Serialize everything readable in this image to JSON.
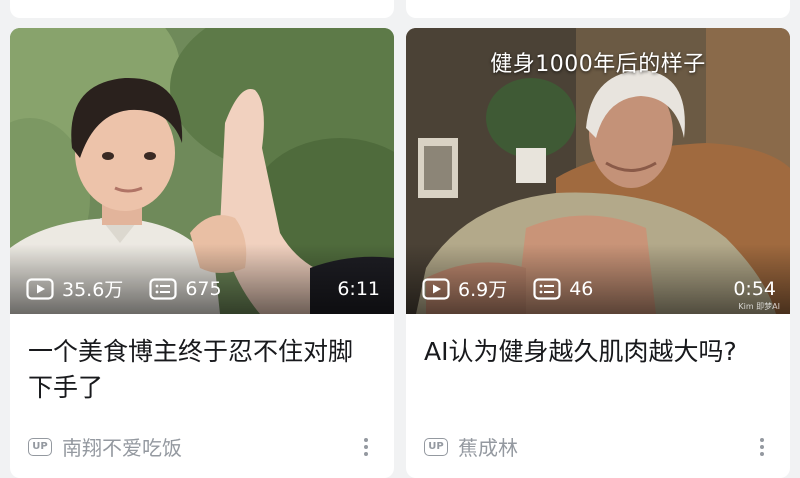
{
  "feed": {
    "cards": [
      {
        "overlay_title": "",
        "views": "35.6万",
        "comments": "675",
        "duration": "6:11",
        "title": "一个美食博主终于忍不住对脚下手了",
        "up_badge": "UP",
        "author": "南翔不爱吃饭"
      },
      {
        "overlay_title": "健身1000年后的样子",
        "views": "6.9万",
        "comments": "46",
        "duration": "0:54",
        "title": "AI认为健身越久肌肉越大吗?",
        "up_badge": "UP",
        "author": "蕉成林",
        "watermark": "Kim 即梦AI"
      }
    ]
  },
  "colors": {
    "background": "#f1f2f3",
    "card": "#ffffff",
    "text_primary": "#18191c",
    "text_secondary": "#9499a0"
  },
  "icons": [
    "play-count-icon",
    "comment-count-icon",
    "up-badge",
    "more-options-icon"
  ]
}
